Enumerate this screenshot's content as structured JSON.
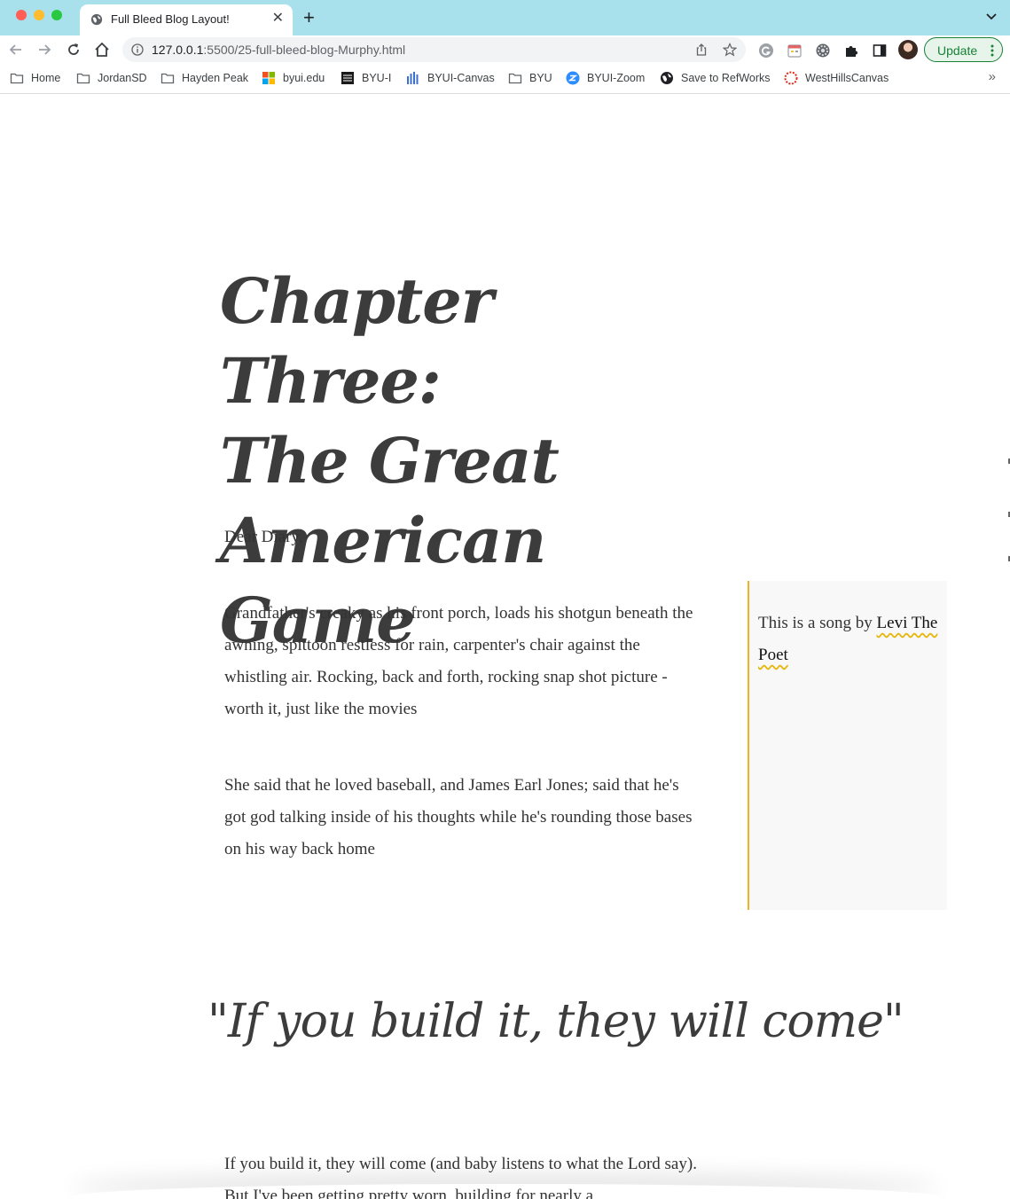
{
  "browser": {
    "tab_title": "Full Bleed Blog Layout!",
    "url_host": "127.0.0.1",
    "url_path": ":5500/25-full-bleed-blog-Murphy.html",
    "update_label": "Update"
  },
  "bookmarks": [
    {
      "label": "Home",
      "icon": "folder-icon"
    },
    {
      "label": "JordanSD",
      "icon": "folder-icon"
    },
    {
      "label": "Hayden Peak",
      "icon": "folder-icon"
    },
    {
      "label": "byui.edu",
      "icon": "microsoft-icon"
    },
    {
      "label": "BYU-I",
      "icon": "byu-icon"
    },
    {
      "label": "BYUI-Canvas",
      "icon": "bars-icon"
    },
    {
      "label": "BYU",
      "icon": "folder-icon"
    },
    {
      "label": "BYUI-Zoom",
      "icon": "zoom-icon"
    },
    {
      "label": "Save to RefWorks",
      "icon": "globe-icon"
    },
    {
      "label": "WestHillsCanvas",
      "icon": "canvas-icon"
    }
  ],
  "article": {
    "title_lines": [
      "Chapter Three:",
      "The Great",
      "American Game"
    ],
    "greeting": "Dear Diary,",
    "paragraph_1": "Grandfather's creaky as his front porch, loads his shotgun beneath the awning, spittoon restless for rain, carpenter's chair against the whistling air. Rocking, back and forth, rocking snap shot picture - worth it, just like the movies",
    "paragraph_2": "She said that he loved baseball, and James Earl Jones; said that he's got god talking inside of his thoughts while he's rounding those bases on his way back home",
    "sidebar_prefix": "This is a song by ",
    "sidebar_link": "Levi The Poet",
    "pull_quote": "\"If you build it, they will come\"",
    "paragraph_3": "If you build it, they will come (and baby listens to what the Lord say). But I've been getting pretty worn, building for nearly a"
  },
  "colors": {
    "tab_bar": "#a8e1ec",
    "sidebar_border": "#f0b323",
    "sidebar_bg": "#f8f8f8",
    "heading": "#3c3c3c",
    "update_green": "#188038"
  }
}
